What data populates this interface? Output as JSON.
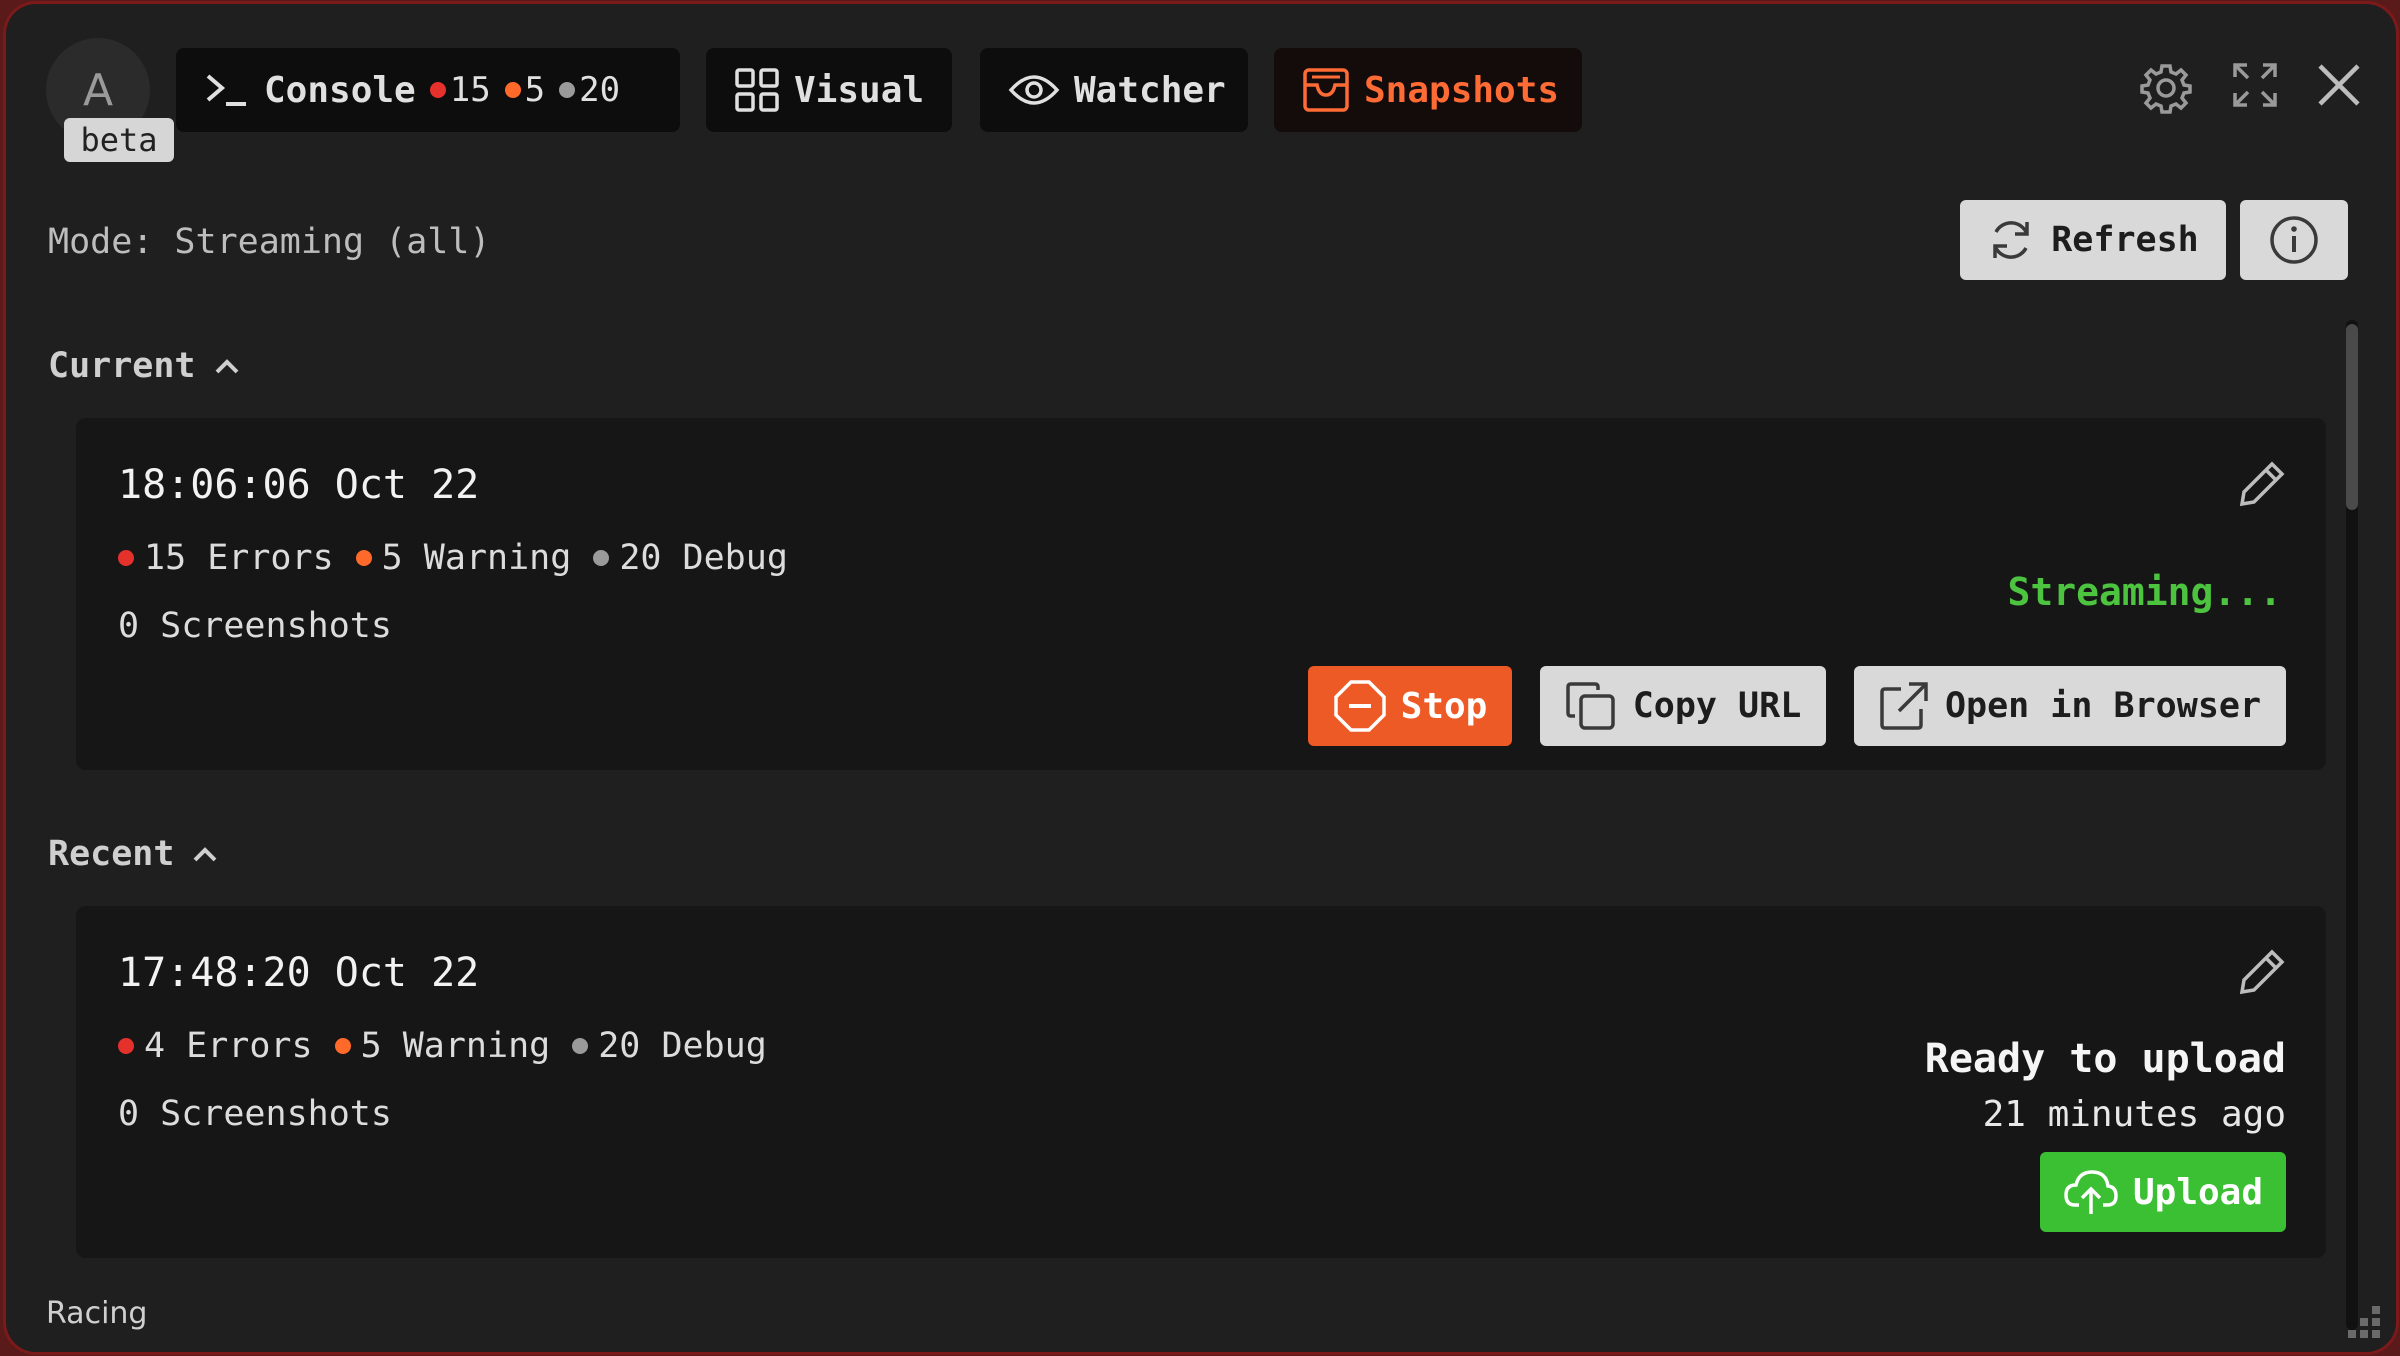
{
  "header": {
    "avatar_letter": "A",
    "beta_label": "beta",
    "tabs": [
      {
        "label": "Console",
        "icon": "terminal-prompt-icon",
        "counts": {
          "errors": "15",
          "warnings": "5",
          "debug": "20"
        }
      },
      {
        "label": "Visual",
        "icon": "grid-icon"
      },
      {
        "label": "Watcher",
        "icon": "eye-icon"
      },
      {
        "label": "Snapshots",
        "icon": "inbox-tray-icon",
        "active": true
      }
    ],
    "icons": [
      "gear-icon",
      "fullscreen-icon",
      "close-icon"
    ]
  },
  "toolbar": {
    "mode_text": "Mode: Streaming (all)",
    "refresh_label": "Refresh",
    "refresh_icon": "refresh-icon",
    "info_icon": "info-icon"
  },
  "current": {
    "section_label": "Current",
    "time": "18:06:06 Oct 22",
    "errors": "15 Errors",
    "warnings": "5 Warning",
    "debug": "20 Debug",
    "screenshots": "0 Screenshots",
    "status": "Streaming...",
    "stop_label": "Stop",
    "copy_url_label": "Copy URL",
    "open_browser_label": "Open in Browser"
  },
  "recent": {
    "section_label": "Recent",
    "items": [
      {
        "time": "17:48:20 Oct 22",
        "errors": "4 Errors",
        "warnings": "5 Warning",
        "debug": "20 Debug",
        "screenshots": "0 Screenshots",
        "status": "Ready to upload",
        "ago": "21 minutes ago",
        "upload_label": "Upload"
      }
    ]
  },
  "footer": {
    "text": "Racing"
  },
  "colors": {
    "accent": "#ff6b35",
    "error": "#e5312c",
    "warning": "#ff6a2a",
    "debug": "#9a9a9a",
    "streaming": "#4cc43f",
    "upload": "#3bbf33",
    "background": "#1f1f1f"
  }
}
